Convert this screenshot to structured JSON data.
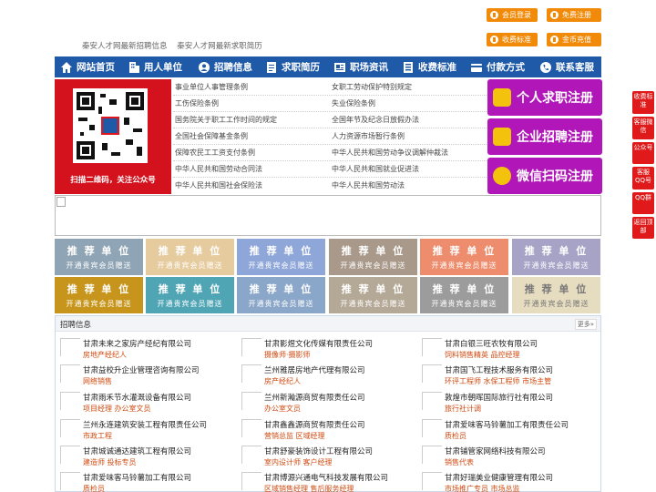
{
  "top_buttons": [
    {
      "label": "会员登录",
      "icon": "user-icon"
    },
    {
      "label": "免费注册",
      "icon": "register-icon"
    },
    {
      "label": "收费标准",
      "icon": "price-icon"
    },
    {
      "label": "金币充值",
      "icon": "coin-icon"
    }
  ],
  "top_links": [
    "秦安人才网最新招聘信息",
    "秦安人才网最新求职简历"
  ],
  "nav": [
    {
      "label": "网站首页",
      "icon": "home-icon"
    },
    {
      "label": "用人单位",
      "icon": "building-icon"
    },
    {
      "label": "招聘信息",
      "icon": "recruit-icon"
    },
    {
      "label": "求职简历",
      "icon": "resume-icon"
    },
    {
      "label": "职场资讯",
      "icon": "news-icon"
    },
    {
      "label": "收费标准",
      "icon": "price-icon"
    },
    {
      "label": "付款方式",
      "icon": "payment-icon"
    },
    {
      "label": "联系客服",
      "icon": "service-icon"
    }
  ],
  "qr_caption": "扫描二维码，关注公众号",
  "laws": [
    [
      "事业单位人事管理条例",
      "女职工劳动保护特别规定"
    ],
    [
      "工伤保险条例",
      "失业保险条例"
    ],
    [
      "国务院关于职工工作时间的规定",
      "全国年节及纪念日放假办法"
    ],
    [
      "全国社会保障基金条例",
      "人力资源市场暂行条例"
    ],
    [
      "保障农民工工资支付条例",
      "中华人民共和国劳动争议调解仲裁法"
    ],
    [
      "中华人民共和国劳动合同法",
      "中华人民共和国就业促进法"
    ],
    [
      "中华人民共和国社会保险法",
      "中华人民共和国劳动法"
    ]
  ],
  "register": [
    "个人求职注册",
    "企业招聘注册",
    "微信扫码注册"
  ],
  "ad_slot": {
    "title": "推 荐 单 位",
    "sub": "开通贵宾会员赠送"
  },
  "jobs_title": "招聘信息",
  "jobs_more": "更多»",
  "jobs": [
    {
      "company": "甘肃未来之家房产经纪有限公司",
      "positions": "房地产经纪人"
    },
    {
      "company": "甘肃影煜文化传媒有限责任公司",
      "positions": "摄像师·摄影师"
    },
    {
      "company": "甘肃白银三旺农牧有限公司",
      "positions": "饲料销售精英 品控经理"
    },
    {
      "company": "甘肃益校升企业管理咨询有限公司",
      "positions": "网络销售"
    },
    {
      "company": "兰州雅居房地产代理有限公司",
      "positions": "房产经纪人"
    },
    {
      "company": "甘肃国飞工程技术服务有限公司",
      "positions": "环评工程师 水保工程师 市场主管"
    },
    {
      "company": "甘肃雨禾节水灌溉设备有限公司",
      "positions": "项目经理 办公室文员"
    },
    {
      "company": "兰州新瀚源商贸有限责任公司",
      "positions": "办公室文员"
    },
    {
      "company": "敦煌市朝晖国际旅行社有限公司",
      "positions": "旅行社计调"
    },
    {
      "company": "兰州永连建筑安装工程有限责任公司",
      "positions": "市政工程"
    },
    {
      "company": "甘肃鑫鑫源商贸有限责任公司",
      "positions": "营销总监 区域经理"
    },
    {
      "company": "甘肃爱味客马铃薯加工有限责任公司",
      "positions": "质检员"
    },
    {
      "company": "甘肃城诚通达建筑工程有限公司",
      "positions": "建造师 投标专员"
    },
    {
      "company": "甘肃舒豪装饰设计工程有限公司",
      "positions": "室内设计师 客户经理"
    },
    {
      "company": "甘肃铺管家网络科技有限公司",
      "positions": "销售代表"
    },
    {
      "company": "甘肃爱味客马铃薯加工有限公司",
      "positions": "质检员"
    },
    {
      "company": "甘肃博源兴通电气科技发展有限公司",
      "positions": "区域销售经理 售后服务经理"
    },
    {
      "company": "甘肃好瑞美业健康管理有限公司",
      "positions": "市场推广专员 市场总监"
    }
  ],
  "side_tabs": [
    "收费标准",
    "客服微信",
    "公众号",
    "客服QQ号",
    "QQ群",
    "返回顶部"
  ],
  "colors": {
    "nav": "#1f5aa8",
    "orange": "#f08a08",
    "register": "#b016b8",
    "side": "#e01a1a"
  }
}
